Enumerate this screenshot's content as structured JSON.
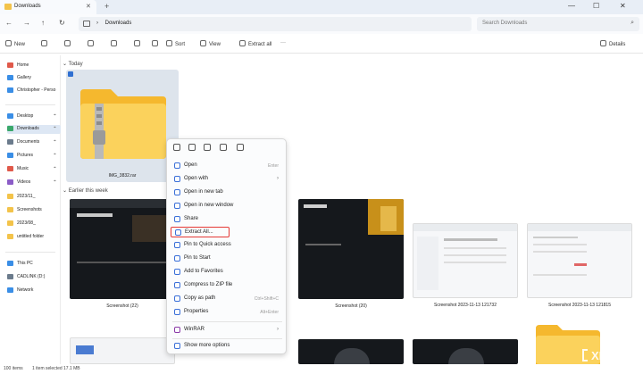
{
  "titlebar": {
    "tab_title": "Downloads",
    "close_glyph": "✕",
    "new_tab_glyph": "+",
    "min_glyph": "—",
    "max_glyph": "☐",
    "close_win_glyph": "✕"
  },
  "address": {
    "breadcrumb": "Downloads",
    "chevron": "›",
    "search_placeholder": "Search Downloads",
    "search_glyph": "⌕"
  },
  "nav": {
    "back": "←",
    "forward": "→",
    "up": "↑",
    "refresh": "↻"
  },
  "commands": {
    "new": "New",
    "sort": "Sort",
    "view": "View",
    "extract_all": "Extract all",
    "more": "···",
    "details": "Details"
  },
  "sidebar": {
    "items": [
      {
        "label": "Home",
        "icon": "home-icon",
        "color": "#e0594a"
      },
      {
        "label": "Gallery",
        "icon": "gallery-icon",
        "color": "#3a8ee6"
      },
      {
        "label": "Christopher - Perso",
        "icon": "cloud-icon",
        "color": "#3a8ee6"
      },
      {
        "label": "Desktop",
        "icon": "desktop-icon",
        "color": "#3a8ee6"
      },
      {
        "label": "Downloads",
        "icon": "download-icon",
        "color": "#3aa86b"
      },
      {
        "label": "Documents",
        "icon": "document-icon",
        "color": "#6b7b8c"
      },
      {
        "label": "Pictures",
        "icon": "pictures-icon",
        "color": "#3a8ee6"
      },
      {
        "label": "Music",
        "icon": "music-icon",
        "color": "#e0594a"
      },
      {
        "label": "Videos",
        "icon": "video-icon",
        "color": "#8b5cc7"
      },
      {
        "label": "2023/11_",
        "icon": "folder-icon",
        "color": "#f3c34a"
      },
      {
        "label": "Screenshots",
        "icon": "folder-icon",
        "color": "#f3c34a"
      },
      {
        "label": "2023/08_",
        "icon": "folder-icon",
        "color": "#f3c34a"
      },
      {
        "label": "untitled folder",
        "icon": "folder-icon",
        "color": "#f3c34a"
      },
      {
        "label": "This PC",
        "icon": "pc-icon",
        "color": "#3a8ee6"
      },
      {
        "label": "CADLINK (D:)",
        "icon": "drive-icon",
        "color": "#6b7b8c"
      },
      {
        "label": "Network",
        "icon": "network-icon",
        "color": "#3a8ee6"
      }
    ],
    "pin_glyph": "⌖"
  },
  "content": {
    "group_today": "Today",
    "group_earlier": "Earlier this week",
    "selected_file": "IMG_3832.rar",
    "files": [
      "Screenshot (22)",
      "Screenshot (20)",
      "Screenshot 2023-11-13 121732",
      "Screenshot 2023-11-13 121815"
    ]
  },
  "context_menu": {
    "items": [
      {
        "label": "Open",
        "shortcut": "Enter"
      },
      {
        "label": "Open with",
        "arrow": "›"
      },
      {
        "label": "Open in new tab"
      },
      {
        "label": "Open in new window"
      },
      {
        "label": "Share"
      },
      {
        "label": "Extract All..."
      },
      {
        "label": "Pin to Quick access"
      },
      {
        "label": "Pin to Start"
      },
      {
        "label": "Add to Favorites"
      },
      {
        "label": "Compress to ZIP file"
      },
      {
        "label": "Copy as path",
        "shortcut": "Ctrl+Shift+C"
      },
      {
        "label": "Properties",
        "shortcut": "Alt+Enter"
      },
      {
        "label": "WinRAR",
        "arrow": "›"
      },
      {
        "label": "Show more options"
      }
    ],
    "highlight_color": "#e53935"
  },
  "status": {
    "items_count": "100 items",
    "selection": "1 item selected  17.1 MB"
  },
  "watermark": {
    "text": "XDA"
  }
}
